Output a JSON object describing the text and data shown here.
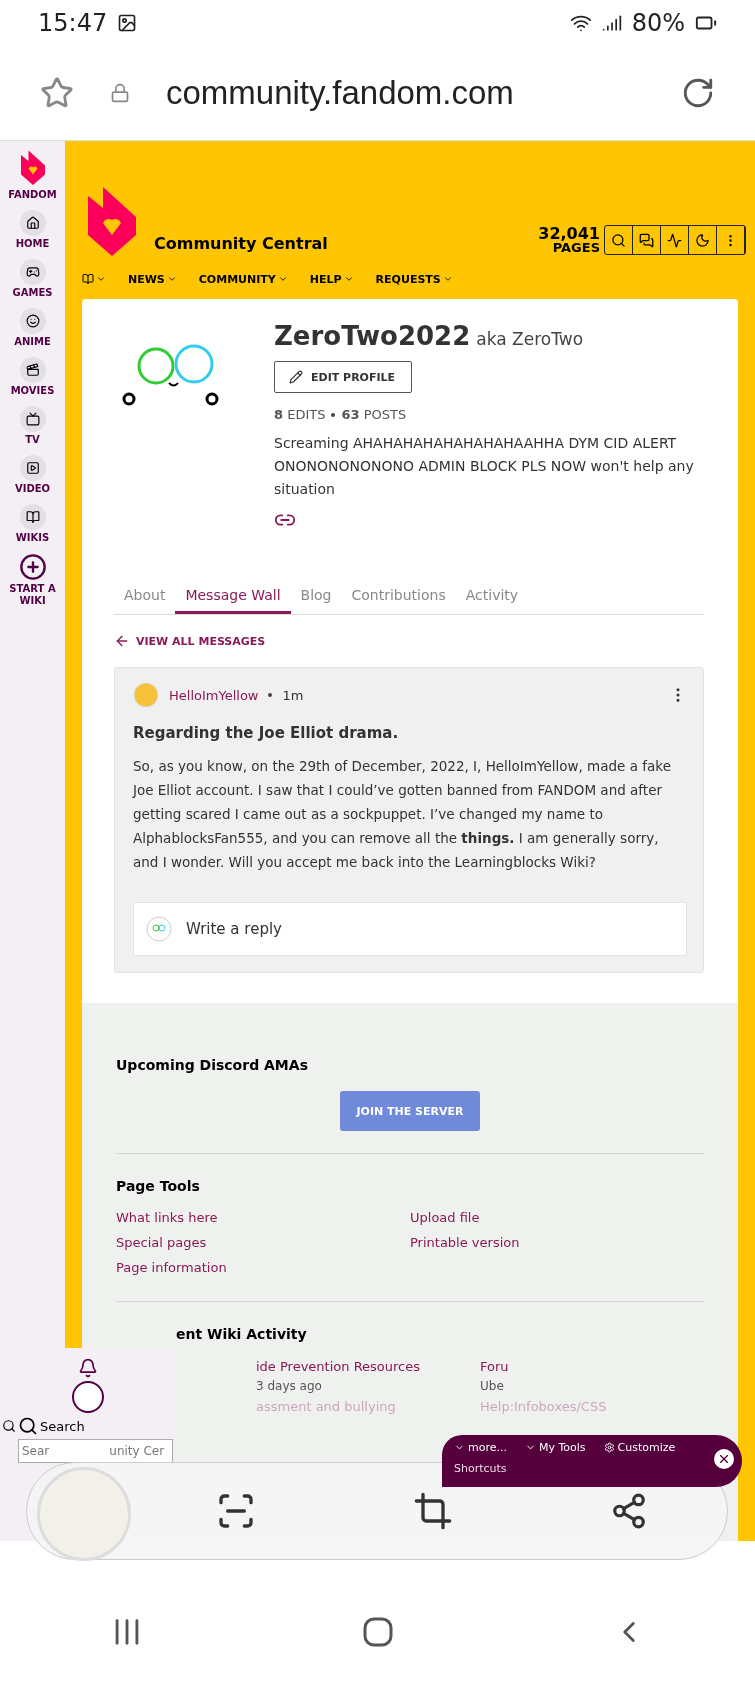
{
  "status_bar": {
    "time": "15:47",
    "battery": "80%"
  },
  "browser": {
    "url": "community.fandom.com"
  },
  "sidebar": {
    "brand": "FANDOM",
    "items": [
      {
        "label": "HOME",
        "kind": "home"
      },
      {
        "label": "GAMES",
        "kind": "games"
      },
      {
        "label": "ANIME",
        "kind": "anime"
      },
      {
        "label": "MOVIES",
        "kind": "movies"
      },
      {
        "label": "TV",
        "kind": "tv"
      },
      {
        "label": "VIDEO",
        "kind": "video"
      },
      {
        "label": "WIKIS",
        "kind": "wikis"
      },
      {
        "label": "START A WIKI",
        "kind": "start"
      }
    ]
  },
  "wiki_header": {
    "title": "Community Central",
    "page_count": "32,041",
    "page_label": "PAGES",
    "nav": [
      "NEWS",
      "COMMUNITY",
      "HELP",
      "REQUESTS"
    ]
  },
  "profile": {
    "username": "ZeroTwo2022",
    "aka": "aka ZeroTwo",
    "edit_button": "EDIT PROFILE",
    "edits_count": "8",
    "edits_label": "EDITS",
    "posts_count": "63",
    "posts_label": "POSTS",
    "bio": "Screaming AHAHAHAHAHAHAHAHAAHHA DYM CID ALERT ONONONONONONO ADMIN BLOCK PLS NOW won't help any situation"
  },
  "tabs": [
    {
      "label": "About",
      "selected": false
    },
    {
      "label": "Message Wall",
      "selected": true
    },
    {
      "label": "Blog",
      "selected": false
    },
    {
      "label": "Contributions",
      "selected": false
    },
    {
      "label": "Activity",
      "selected": false
    }
  ],
  "view_all": "VIEW ALL MESSAGES",
  "message": {
    "author": "HelloImYellow",
    "time": "1m",
    "title": "Regarding the Joe Elliot drama.",
    "body": "So, as you know, on the 29th of December, 2022, I, HelloImYellow, made a fake Joe Elliot account. I saw that I could’ve gotten banned from FANDOM and after getting scared I came out as a sockpuppet. I’ve changed my name to AlphablocksFan555, and you can remove all the **things.** I am generally sorry, and I wonder. Will you accept me back into the Learningblocks Wiki?",
    "reply_placeholder": "Write a reply"
  },
  "discord": {
    "title": "Upcoming Discord AMAs",
    "button": "JOIN THE SERVER"
  },
  "page_tools": {
    "title": "Page Tools",
    "links": [
      "What links here",
      "Upload file",
      "Special pages",
      "Printable version",
      "Page information"
    ]
  },
  "activity": {
    "title": "ent Wiki Activity",
    "items": [
      {
        "title": "ide Prevention Resources",
        "meta": "3 days ago"
      },
      {
        "title": "Foru",
        "meta": "Ube"
      },
      {
        "title": "assment and bullying"
      },
      {
        "title": "Help:Infoboxes/CSS"
      }
    ]
  },
  "overlay_search": {
    "label": "Search",
    "placeholder": "Sear",
    "tail": "unity Cer"
  },
  "toolbar": {
    "items": [
      "more...",
      "My Tools",
      "Customize"
    ],
    "shortcuts": "Shortcuts"
  }
}
